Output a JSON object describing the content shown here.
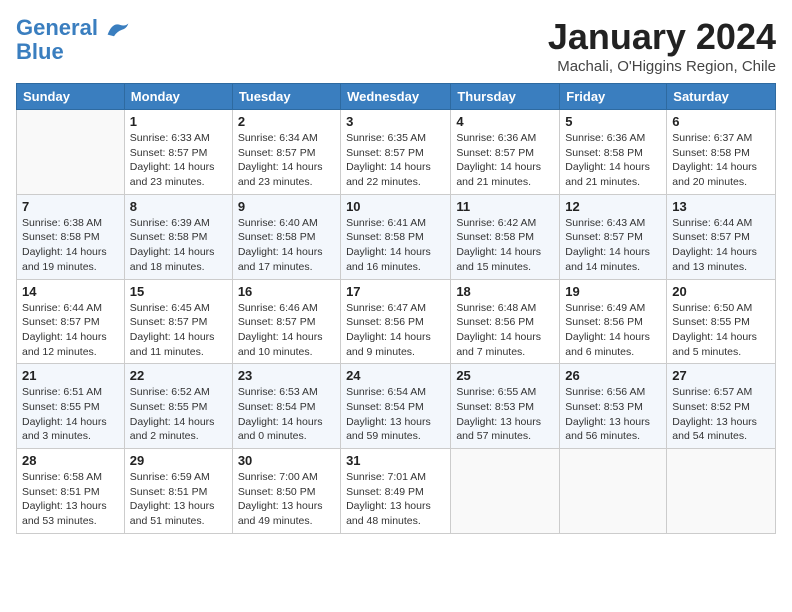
{
  "header": {
    "logo_line1": "General",
    "logo_line2": "Blue",
    "title": "January 2024",
    "subtitle": "Machali, O'Higgins Region, Chile"
  },
  "weekdays": [
    "Sunday",
    "Monday",
    "Tuesday",
    "Wednesday",
    "Thursday",
    "Friday",
    "Saturday"
  ],
  "weeks": [
    [
      {
        "day": "",
        "info": ""
      },
      {
        "day": "1",
        "info": "Sunrise: 6:33 AM\nSunset: 8:57 PM\nDaylight: 14 hours\nand 23 minutes."
      },
      {
        "day": "2",
        "info": "Sunrise: 6:34 AM\nSunset: 8:57 PM\nDaylight: 14 hours\nand 23 minutes."
      },
      {
        "day": "3",
        "info": "Sunrise: 6:35 AM\nSunset: 8:57 PM\nDaylight: 14 hours\nand 22 minutes."
      },
      {
        "day": "4",
        "info": "Sunrise: 6:36 AM\nSunset: 8:57 PM\nDaylight: 14 hours\nand 21 minutes."
      },
      {
        "day": "5",
        "info": "Sunrise: 6:36 AM\nSunset: 8:58 PM\nDaylight: 14 hours\nand 21 minutes."
      },
      {
        "day": "6",
        "info": "Sunrise: 6:37 AM\nSunset: 8:58 PM\nDaylight: 14 hours\nand 20 minutes."
      }
    ],
    [
      {
        "day": "7",
        "info": "Sunrise: 6:38 AM\nSunset: 8:58 PM\nDaylight: 14 hours\nand 19 minutes."
      },
      {
        "day": "8",
        "info": "Sunrise: 6:39 AM\nSunset: 8:58 PM\nDaylight: 14 hours\nand 18 minutes."
      },
      {
        "day": "9",
        "info": "Sunrise: 6:40 AM\nSunset: 8:58 PM\nDaylight: 14 hours\nand 17 minutes."
      },
      {
        "day": "10",
        "info": "Sunrise: 6:41 AM\nSunset: 8:58 PM\nDaylight: 14 hours\nand 16 minutes."
      },
      {
        "day": "11",
        "info": "Sunrise: 6:42 AM\nSunset: 8:58 PM\nDaylight: 14 hours\nand 15 minutes."
      },
      {
        "day": "12",
        "info": "Sunrise: 6:43 AM\nSunset: 8:57 PM\nDaylight: 14 hours\nand 14 minutes."
      },
      {
        "day": "13",
        "info": "Sunrise: 6:44 AM\nSunset: 8:57 PM\nDaylight: 14 hours\nand 13 minutes."
      }
    ],
    [
      {
        "day": "14",
        "info": "Sunrise: 6:44 AM\nSunset: 8:57 PM\nDaylight: 14 hours\nand 12 minutes."
      },
      {
        "day": "15",
        "info": "Sunrise: 6:45 AM\nSunset: 8:57 PM\nDaylight: 14 hours\nand 11 minutes."
      },
      {
        "day": "16",
        "info": "Sunrise: 6:46 AM\nSunset: 8:57 PM\nDaylight: 14 hours\nand 10 minutes."
      },
      {
        "day": "17",
        "info": "Sunrise: 6:47 AM\nSunset: 8:56 PM\nDaylight: 14 hours\nand 9 minutes."
      },
      {
        "day": "18",
        "info": "Sunrise: 6:48 AM\nSunset: 8:56 PM\nDaylight: 14 hours\nand 7 minutes."
      },
      {
        "day": "19",
        "info": "Sunrise: 6:49 AM\nSunset: 8:56 PM\nDaylight: 14 hours\nand 6 minutes."
      },
      {
        "day": "20",
        "info": "Sunrise: 6:50 AM\nSunset: 8:55 PM\nDaylight: 14 hours\nand 5 minutes."
      }
    ],
    [
      {
        "day": "21",
        "info": "Sunrise: 6:51 AM\nSunset: 8:55 PM\nDaylight: 14 hours\nand 3 minutes."
      },
      {
        "day": "22",
        "info": "Sunrise: 6:52 AM\nSunset: 8:55 PM\nDaylight: 14 hours\nand 2 minutes."
      },
      {
        "day": "23",
        "info": "Sunrise: 6:53 AM\nSunset: 8:54 PM\nDaylight: 14 hours\nand 0 minutes."
      },
      {
        "day": "24",
        "info": "Sunrise: 6:54 AM\nSunset: 8:54 PM\nDaylight: 13 hours\nand 59 minutes."
      },
      {
        "day": "25",
        "info": "Sunrise: 6:55 AM\nSunset: 8:53 PM\nDaylight: 13 hours\nand 57 minutes."
      },
      {
        "day": "26",
        "info": "Sunrise: 6:56 AM\nSunset: 8:53 PM\nDaylight: 13 hours\nand 56 minutes."
      },
      {
        "day": "27",
        "info": "Sunrise: 6:57 AM\nSunset: 8:52 PM\nDaylight: 13 hours\nand 54 minutes."
      }
    ],
    [
      {
        "day": "28",
        "info": "Sunrise: 6:58 AM\nSunset: 8:51 PM\nDaylight: 13 hours\nand 53 minutes."
      },
      {
        "day": "29",
        "info": "Sunrise: 6:59 AM\nSunset: 8:51 PM\nDaylight: 13 hours\nand 51 minutes."
      },
      {
        "day": "30",
        "info": "Sunrise: 7:00 AM\nSunset: 8:50 PM\nDaylight: 13 hours\nand 49 minutes."
      },
      {
        "day": "31",
        "info": "Sunrise: 7:01 AM\nSunset: 8:49 PM\nDaylight: 13 hours\nand 48 minutes."
      },
      {
        "day": "",
        "info": ""
      },
      {
        "day": "",
        "info": ""
      },
      {
        "day": "",
        "info": ""
      }
    ]
  ]
}
